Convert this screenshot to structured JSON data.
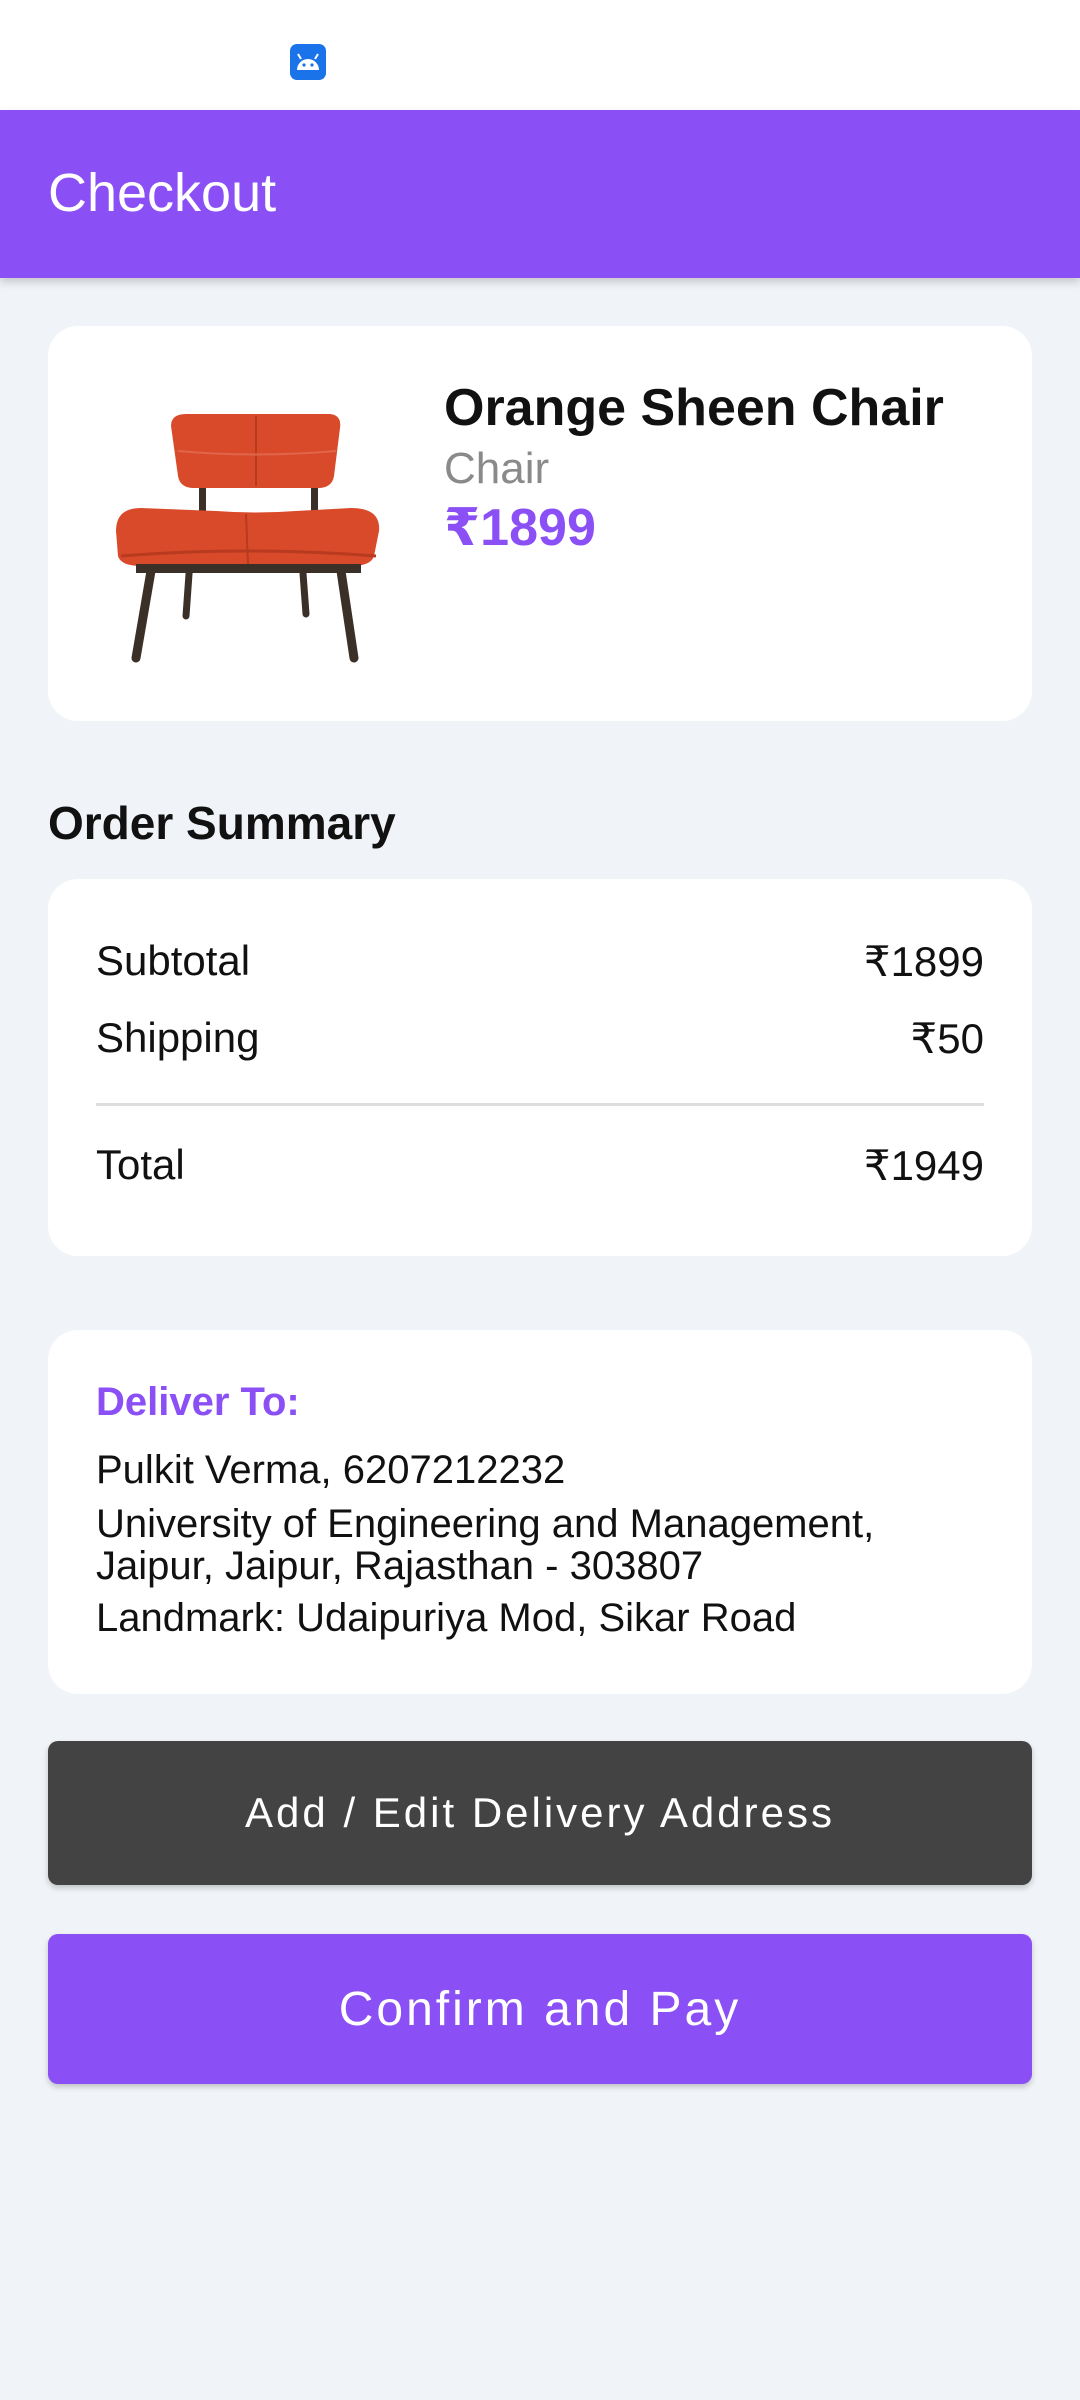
{
  "status_bar": {
    "icon": "android-icon"
  },
  "header": {
    "title": "Checkout"
  },
  "product": {
    "name": "Orange Sheen Chair",
    "category": "Chair",
    "price": "₹1899",
    "image": "orange-chair-image"
  },
  "order_summary": {
    "heading": "Order Summary",
    "subtotal_label": "Subtotal",
    "subtotal_value": "₹1899",
    "shipping_label": "Shipping",
    "shipping_value": "₹50",
    "total_label": "Total",
    "total_value": "₹1949"
  },
  "delivery": {
    "label": "Deliver To:",
    "name_phone": "Pulkit Verma, 6207212232",
    "address_line1": "University of Engineering and Management,",
    "address_line2": "Jaipur, Jaipur, Rajasthan - 303807",
    "landmark": "Landmark: Udaipuriya Mod, Sikar Road"
  },
  "buttons": {
    "edit_address": "Add / Edit Delivery Address",
    "confirm_pay": "Confirm and Pay"
  },
  "colors": {
    "accent": "#8a4ff5",
    "dark_button": "#434343",
    "background": "#f0f3f7"
  }
}
